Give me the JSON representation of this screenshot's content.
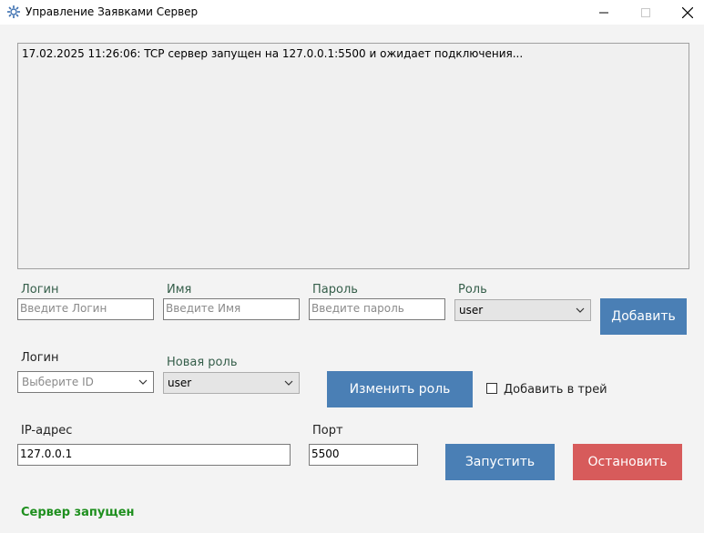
{
  "window": {
    "title": "Управление Заявками Сервер",
    "icon": "app-gear-icon"
  },
  "log": {
    "lines": [
      "17.02.2025 11:26:06: TCP сервер запущен на 127.0.0.1:5500 и ожидает подключения..."
    ]
  },
  "add_user": {
    "login_label": "Логин",
    "login_placeholder": "Введите Логин",
    "name_label": "Имя",
    "name_placeholder": "Введите Имя",
    "password_label": "Пароль",
    "password_placeholder": "Введите пароль",
    "role_label": "Роль",
    "role_value": "user",
    "add_button": "Добавить"
  },
  "change_role": {
    "login_label": "Логин",
    "login_placeholder": "Выберите ID",
    "new_role_label": "Новая роль",
    "new_role_value": "user",
    "change_button": "Изменить роль",
    "tray_checkbox_label": "Добавить в трей",
    "tray_checked": false
  },
  "server": {
    "ip_label": "IP-адрес",
    "ip_value": "127.0.0.1",
    "port_label": "Порт",
    "port_value": "5500",
    "start_button": "Запустить",
    "stop_button": "Остановить",
    "status_text": "Сервер запущен"
  },
  "colors": {
    "button_blue": "#4a7fb5",
    "button_red": "#d75b5b",
    "status_green": "#1e8f1e"
  }
}
